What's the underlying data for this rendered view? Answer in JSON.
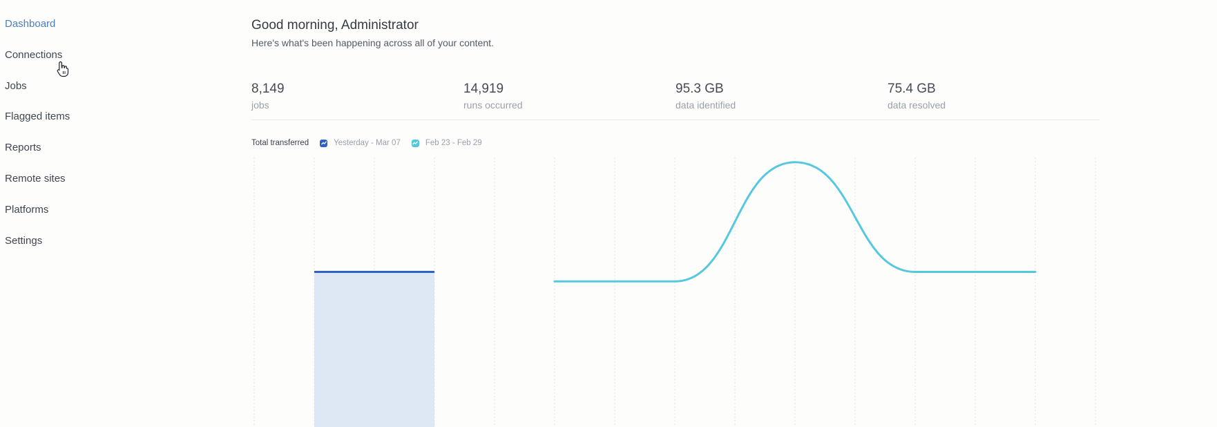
{
  "sidebar": {
    "items": [
      {
        "label": "Dashboard",
        "active": true
      },
      {
        "label": "Connections"
      },
      {
        "label": "Jobs"
      },
      {
        "label": "Flagged items"
      },
      {
        "label": "Reports"
      },
      {
        "label": "Remote sites"
      },
      {
        "label": "Platforms"
      },
      {
        "label": "Settings"
      }
    ]
  },
  "header": {
    "greeting": "Good morning, Administrator",
    "subtitle": "Here's what's been happening across all of your content."
  },
  "stats": [
    {
      "value": "8,149",
      "label": "jobs"
    },
    {
      "value": "14,919",
      "label": "runs occurred"
    },
    {
      "value": "95.3 GB",
      "label": "data identified"
    },
    {
      "value": "75.4 GB",
      "label": "data resolved"
    }
  ],
  "colors": {
    "accent": "#4a7fc0",
    "series_current": "#2d62c4",
    "series_current_fill": "#dde8f4",
    "series_previous": "#56c8de",
    "grid": "#e2e4e7"
  },
  "chart_data": {
    "type": "line",
    "title": "Total transferred",
    "legend_position": "top-left",
    "grid": true,
    "x_slots": 14,
    "ylim": [
      0,
      2
    ],
    "series": [
      {
        "name": "Yesterday - Mar 07",
        "style": "area",
        "x": [
          1,
          3
        ],
        "values": [
          1,
          1
        ]
      },
      {
        "name": "Feb 23 - Feb 29",
        "style": "line",
        "x": [
          5,
          7,
          9,
          11,
          13
        ],
        "values": [
          0.92,
          0.92,
          1.92,
          1,
          1
        ]
      }
    ]
  }
}
